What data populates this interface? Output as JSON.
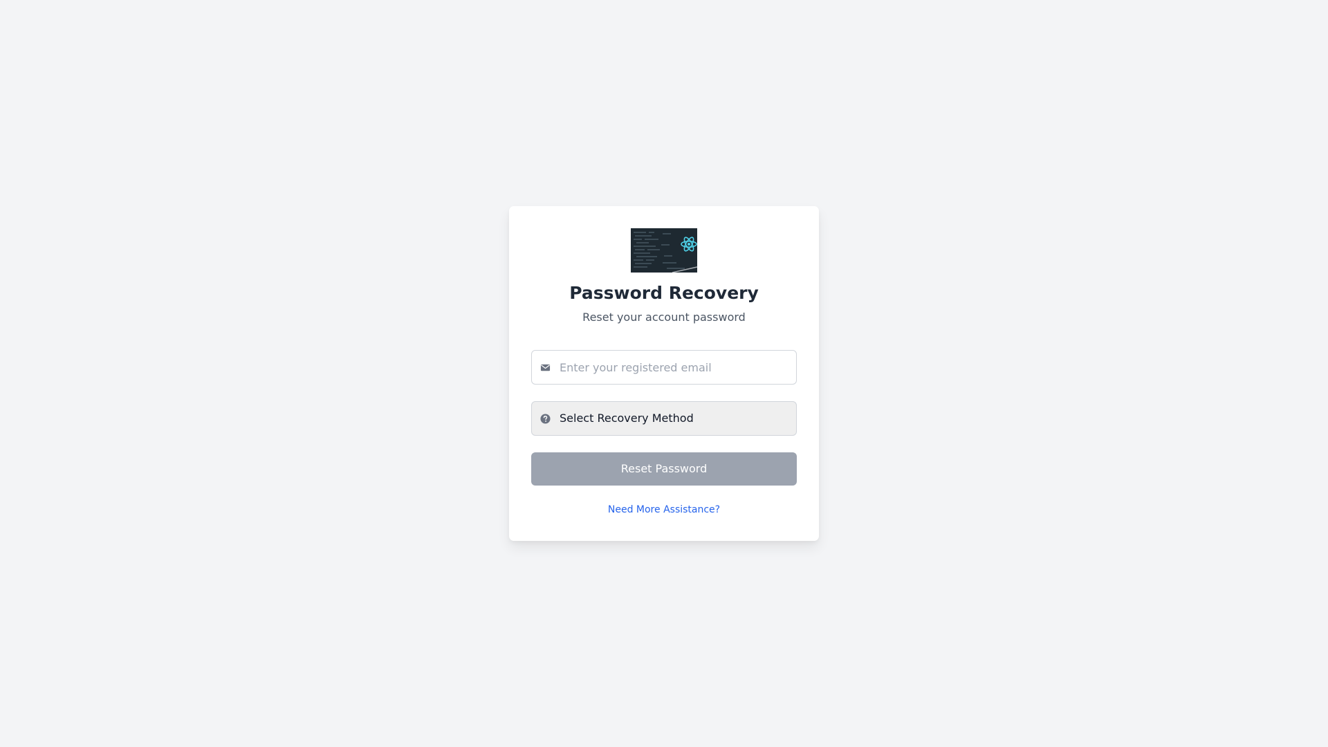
{
  "card": {
    "logo_icon": "react-code-logo",
    "title": "Password Recovery",
    "subtitle": "Reset your account password"
  },
  "form": {
    "email": {
      "icon": "envelope-icon",
      "value": "",
      "placeholder": "Enter your registered email"
    },
    "recovery_method": {
      "icon": "question-circle-icon",
      "selected": "Select Recovery Method"
    },
    "submit_label": "Reset Password",
    "help_link": "Need More Assistance?"
  },
  "colors": {
    "background": "#f3f4f6",
    "card": "#ffffff",
    "button": "#9ca3af",
    "link": "#2563eb",
    "title": "#1f2937"
  }
}
